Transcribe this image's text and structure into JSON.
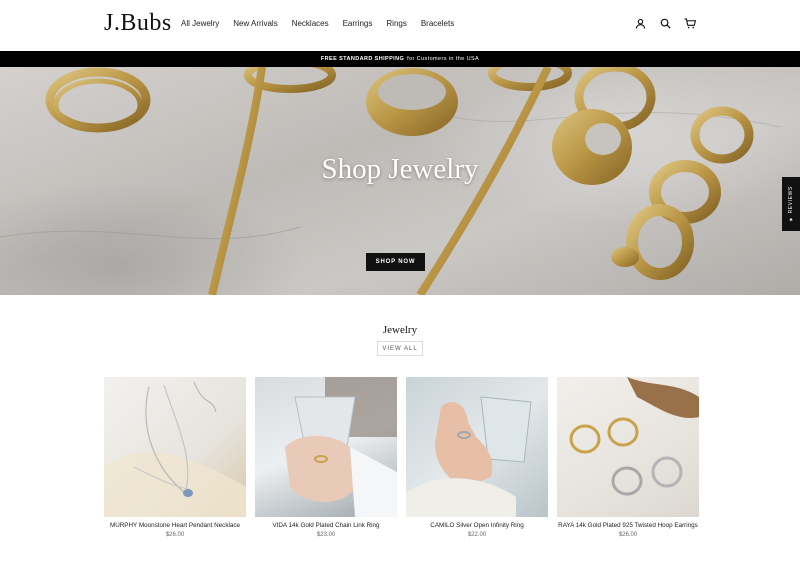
{
  "header": {
    "logo": "J.Bubs",
    "nav": [
      "All Jewelry",
      "New Arrivals",
      "Necklaces",
      "Earrings",
      "Rings",
      "Bracelets"
    ],
    "icons": [
      "user-icon",
      "search-icon",
      "cart-icon"
    ]
  },
  "announcement": {
    "bold": "FREE STANDARD SHIPPING",
    "text": "for Customers in the USA"
  },
  "hero": {
    "title": "Shop Jewelry",
    "button": "SHOP NOW"
  },
  "reviews_tab": "★ REVIEWS",
  "collection": {
    "title": "Jewelry",
    "view_all": "VIEW ALL",
    "products": [
      {
        "name": "MURPHY Moonstone Heart Pendant Necklace",
        "price": "$26.00"
      },
      {
        "name": "VIDA 14k Gold Plated Chain Link Ring",
        "price": "$23.00"
      },
      {
        "name": "CAMILO Silver Open Infinity Ring",
        "price": "$22.00"
      },
      {
        "name": "RAYA 14k Gold Plated 925 Twisted Hoop Earrings",
        "price": "$26.00"
      }
    ]
  },
  "colors": {
    "announcement_bg": "#000000",
    "button_bg": "#111111",
    "gold": "#c9a24a"
  }
}
